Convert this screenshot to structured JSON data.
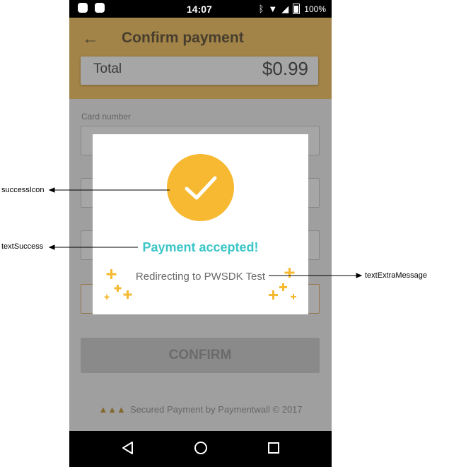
{
  "status_bar": {
    "time": "14:07",
    "battery": "100%",
    "icons": [
      "messenger-icon",
      "android-icon",
      "bluetooth-icon",
      "wifi-icon",
      "signal-icon",
      "battery-icon"
    ]
  },
  "header": {
    "title": "Confirm payment",
    "back_icon": "back-arrow-icon"
  },
  "total": {
    "label": "Total",
    "amount": "$0.99"
  },
  "form": {
    "card_number_label": "Card number"
  },
  "confirm_button": {
    "label": "CONFIRM"
  },
  "footer": {
    "secured_text": "Secured Payment by Paymentwall © 2017"
  },
  "dialog": {
    "success_text": "Payment accepted!",
    "extra_message": "Redirecting to PWSDK Test",
    "icon": "checkmark-icon",
    "accent_color": "#f6b931",
    "success_color": "#3cc5c8"
  },
  "annotations": {
    "success_icon": "successIcon",
    "text_success": "textSuccess",
    "text_extra_message": "textExtraMessage"
  },
  "nav_bar": {
    "icons": [
      "back-triangle-icon",
      "home-circle-icon",
      "recents-square-icon"
    ]
  }
}
